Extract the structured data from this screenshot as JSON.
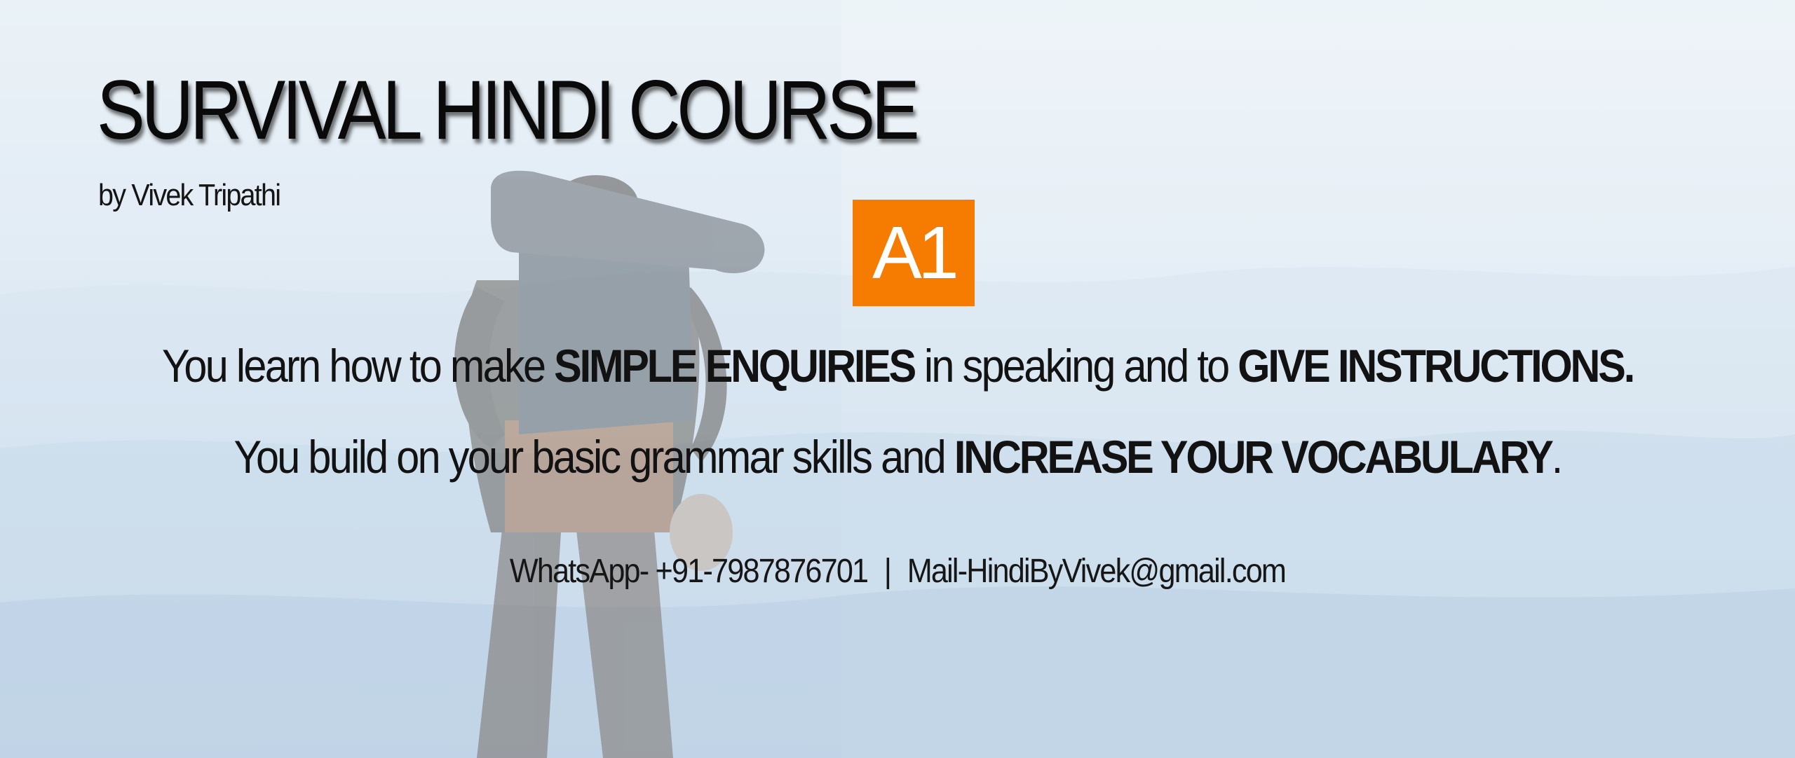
{
  "title": "SURVIVAL HINDI COURSE",
  "byline": "by Vivek Tripathi",
  "level_badge": "A1",
  "line1": {
    "part1": "You learn how to make ",
    "bold1": "SIMPLE ENQUIRIES",
    "part2": " in speaking  and to ",
    "bold2": "GIVE  INSTRUCTIONS."
  },
  "line2": {
    "part1": "You build on your basic grammar skills  and ",
    "bold1": "INCREASE YOUR  VOCABULARY",
    "part2": "."
  },
  "contact": {
    "whatsapp": "WhatsApp- +91-7987876701",
    "separator": "|",
    "mail": "Mail-HindiByVivek@gmail.com"
  },
  "colors": {
    "badge": "#f57c00",
    "text": "#121212"
  }
}
